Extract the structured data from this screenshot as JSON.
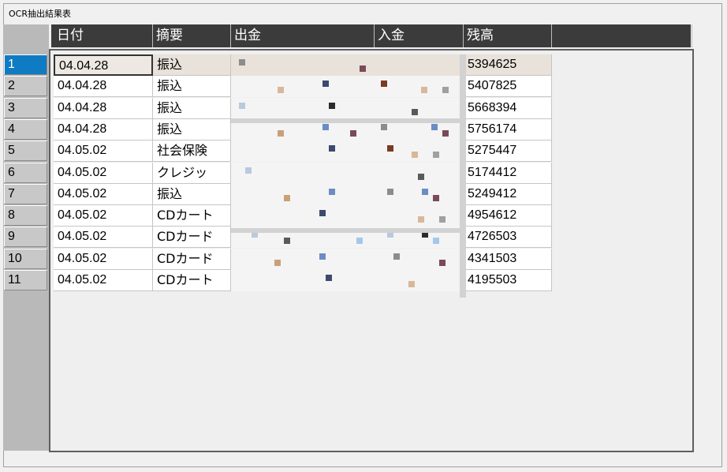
{
  "window": {
    "title": "OCR抽出結果表"
  },
  "columns": [
    "日付",
    "摘要",
    "出金",
    "入金",
    "残高",
    ""
  ],
  "rows": [
    {
      "num": "1",
      "date": "04.04.28",
      "memo": "振込",
      "balance": "5394625"
    },
    {
      "num": "2",
      "date": "04.04.28",
      "memo": "振込",
      "balance": "5407825"
    },
    {
      "num": "3",
      "date": "04.04.28",
      "memo": "振込",
      "balance": "5668394"
    },
    {
      "num": "4",
      "date": "04.04.28",
      "memo": "振込",
      "balance": "5756174"
    },
    {
      "num": "5",
      "date": "04.05.02",
      "memo": "社会保険",
      "balance": "5275447"
    },
    {
      "num": "6",
      "date": "04.05.02",
      "memo": "クレジッ",
      "balance": "5174412"
    },
    {
      "num": "7",
      "date": "04.05.02",
      "memo": "振込",
      "balance": "5249412"
    },
    {
      "num": "8",
      "date": "04.05.02",
      "memo": "CDカート",
      "balance": "4954612"
    },
    {
      "num": "9",
      "date": "04.05.02",
      "memo": "CDカード",
      "balance": "4726503"
    },
    {
      "num": "10",
      "date": "04.05.02",
      "memo": "CDカード",
      "balance": "4341503"
    },
    {
      "num": "11",
      "date": "04.05.02",
      "memo": "CDカート",
      "balance": "4195503"
    }
  ],
  "selected_row": 0,
  "colors": {
    "selection": "#0e7bc3",
    "header": "#3b3b3b",
    "row_highlight": "#e8e2da"
  }
}
